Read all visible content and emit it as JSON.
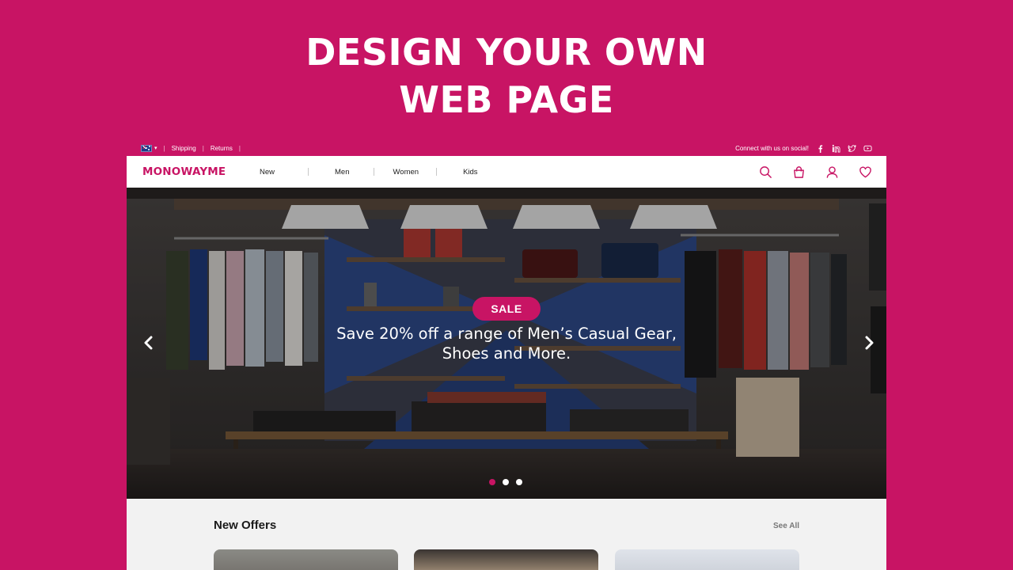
{
  "headline": {
    "line1": "DESIGN YOUR OWN",
    "line2": "WEB PAGE"
  },
  "topbar": {
    "country_flag": "australia-flag-icon",
    "links": [
      "Shipping",
      "Returns"
    ],
    "social_text": "Connect with us on social!",
    "social_icons": [
      "facebook-icon",
      "linkedin-icon",
      "twitter-icon",
      "youtube-icon"
    ]
  },
  "navbar": {
    "logo": "MONOWAYME",
    "links": [
      "New",
      "Men",
      "Women",
      "Kids"
    ],
    "icons": [
      "search-icon",
      "bag-icon",
      "user-icon",
      "heart-icon"
    ]
  },
  "hero": {
    "badge": "SALE",
    "text_line1": "Save 20% off a range of Men’s Casual Gear,",
    "text_line2": "Shoes and More.",
    "slide_count": 3,
    "active_slide": 1
  },
  "offers": {
    "title": "New Offers",
    "see_all": "See All"
  },
  "colors": {
    "brand": "#c81464",
    "white": "#ffffff",
    "panel": "#f2f2f2"
  }
}
